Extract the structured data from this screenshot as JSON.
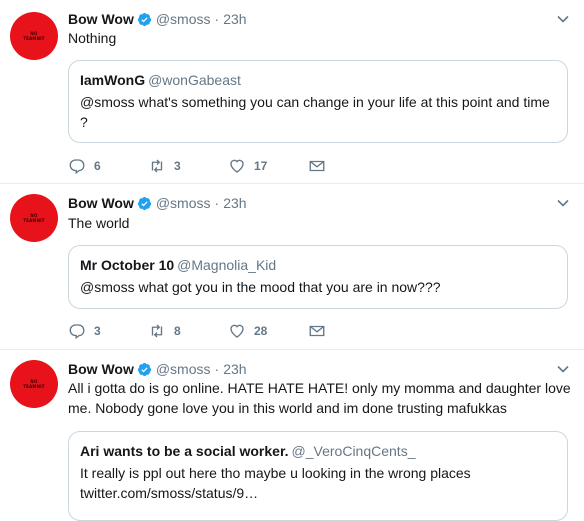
{
  "avatar": {
    "line1": "NO",
    "line2": "TEAMNIT"
  },
  "colors": {
    "avatar_bg": "#e8121b",
    "verified": "#1da1f2",
    "secondary_text": "#657786",
    "border": "#e6ecf0"
  },
  "tweets": [
    {
      "name": "Bow Wow",
      "handle": "@smoss",
      "separator": "·",
      "time": "23h",
      "text": "Nothing",
      "quote": {
        "name": "IamWonG",
        "handle": "@wonGabeast",
        "text": "@smoss what's something you can change in your life at this point and time ?"
      },
      "replies": "6",
      "retweets": "3",
      "likes": "17"
    },
    {
      "name": "Bow Wow",
      "handle": "@smoss",
      "separator": "·",
      "time": "23h",
      "text": "The world",
      "quote": {
        "name": "Mr October 10",
        "handle": "@Magnolia_Kid",
        "text": "@smoss what got you in the mood that you are in now???"
      },
      "replies": "3",
      "retweets": "8",
      "likes": "28"
    },
    {
      "name": "Bow Wow",
      "handle": "@smoss",
      "separator": "·",
      "time": "23h",
      "text": "All i gotta do is go online. HATE HATE HATE! only my momma and daughter love me. Nobody gone love you in this world and im done trusting mafukkas",
      "quote": {
        "name": "Ari wants to be a social worker.",
        "handle": "@_VeroCinqCents_",
        "text": "It really is ppl out here tho maybe u looking in the wrong places twitter.com/smoss/status/9…"
      }
    }
  ]
}
